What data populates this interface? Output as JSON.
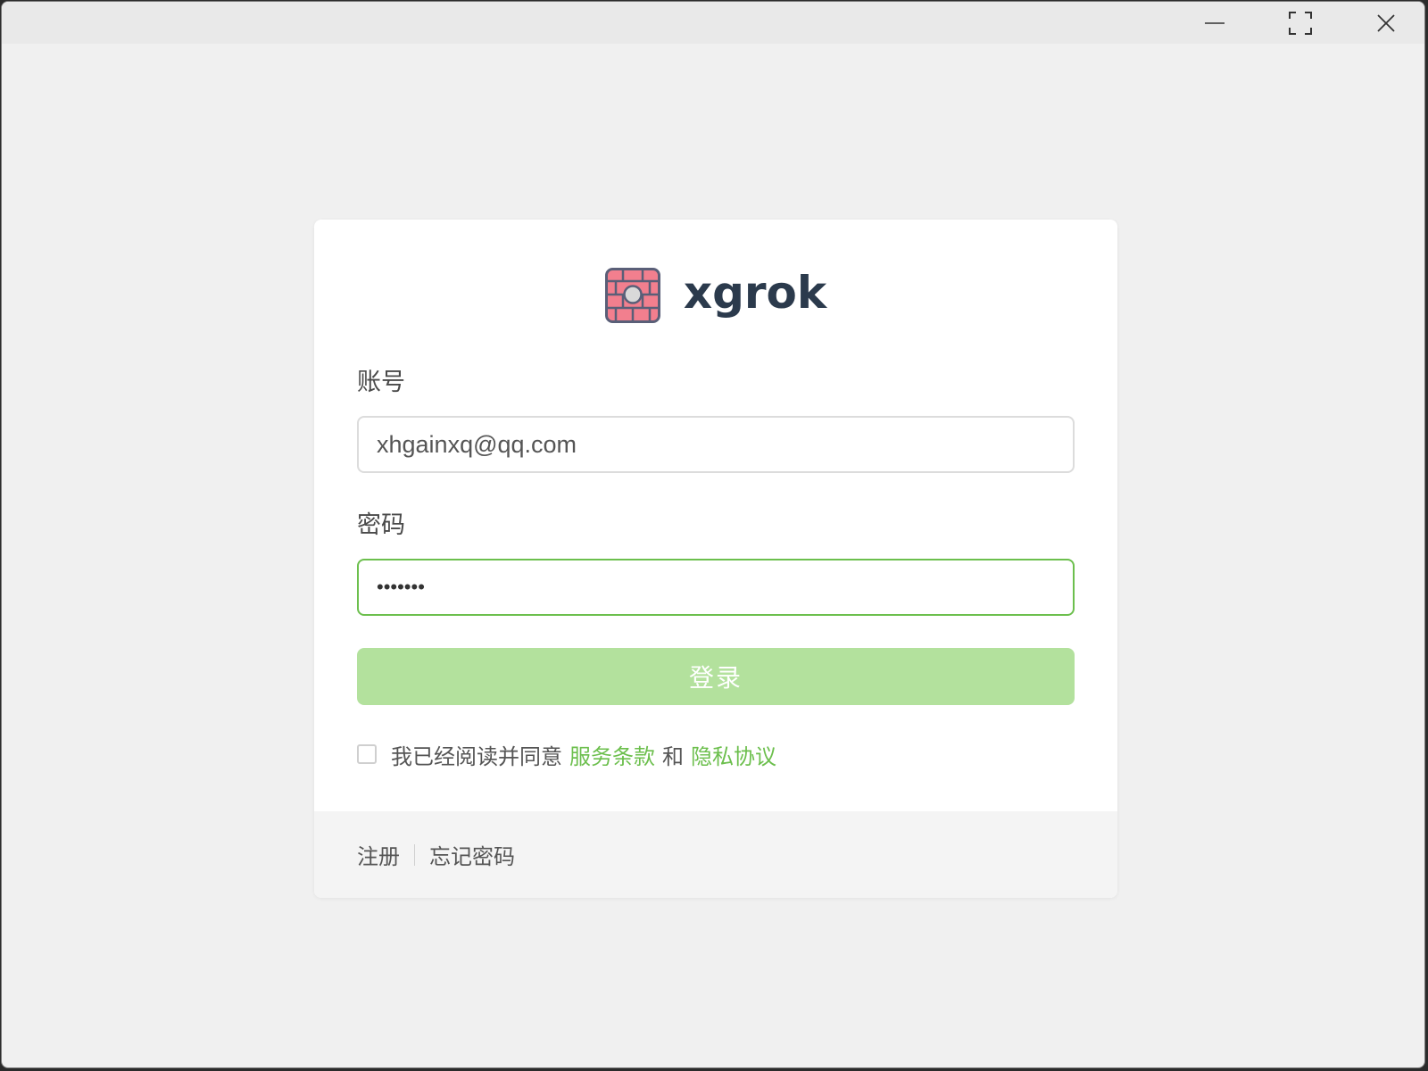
{
  "window": {
    "controls": {
      "minimize_icon": "minimize-icon",
      "maximize_icon": "maximize-icon",
      "close_icon": "close-icon"
    }
  },
  "brand": {
    "name": "xgrok",
    "logo_icon": "firewall-brick-icon",
    "logo_color": "#f27f8e",
    "text_color": "#2b3a4c"
  },
  "form": {
    "account_label": "账号",
    "account_value": "xhgainxq@qq.com",
    "password_label": "密码",
    "password_value": "•••••••",
    "login_label": "登录",
    "agree_text": "我已经阅读并同意",
    "terms_link": "服务条款",
    "and_text": "和",
    "privacy_link": "隐私协议",
    "agree_checked": false
  },
  "footer": {
    "register": "注册",
    "forgot_password": "忘记密码"
  },
  "colors": {
    "accent": "#6cbf4d",
    "button_disabled": "#b3e19d",
    "background": "#f0f0f0"
  }
}
